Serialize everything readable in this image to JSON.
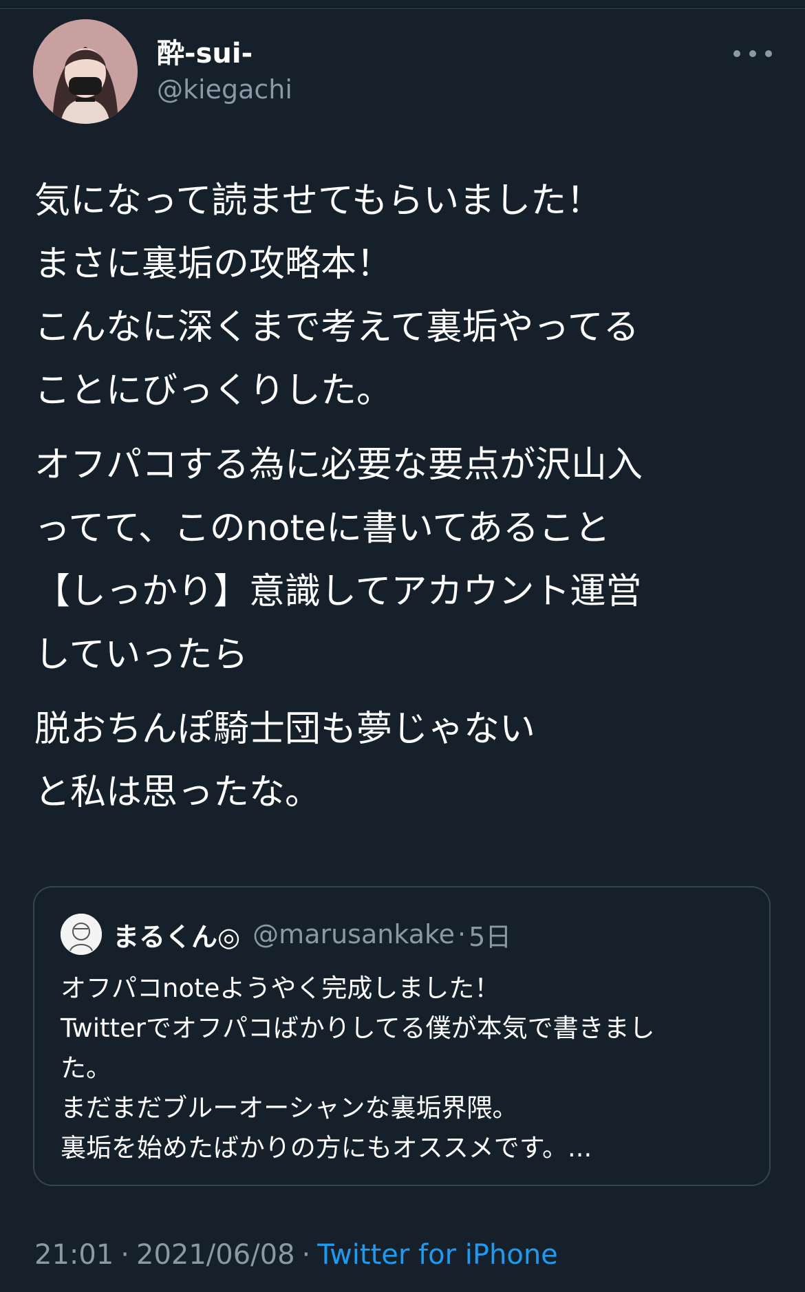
{
  "author": {
    "display_name": "酔-sui-",
    "handle": "@kiegachi"
  },
  "tweet": {
    "paragraphs": [
      [
        "気になって読ませてもらいました！",
        "まさに裏垢の攻略本！",
        "こんなに深くまで考えて裏垢やってる",
        "ことにびっくりした。"
      ],
      [
        "オフパコする為に必要な要点が沢山入",
        "ってて、このnoteに書いてあること",
        "【しっかり】意識してアカウント運営",
        "していったら"
      ],
      [
        "脱おちんぽ騎士団も夢じゃない",
        "と私は思ったな。"
      ]
    ]
  },
  "quote": {
    "display_name": "まるくん◎",
    "handle": "@marusankake",
    "separator": "·",
    "time": "5日",
    "lines": [
      "オフパコnoteようやく完成しました！",
      "Twitterでオフパコばかりしてる僕が本気で書きまし",
      "た。",
      "まだまだブルーオーシャンな裏垢界隈。",
      "裏垢を始めたばかりの方にもオススメです。..."
    ]
  },
  "meta": {
    "time": "21:01",
    "separator": "·",
    "date": "2021/06/08",
    "source": "Twitter for iPhone"
  },
  "colors": {
    "background": "#15202b",
    "text": "#ffffff",
    "secondary": "#8b98a5",
    "accent": "#1d9bf0",
    "border": "#38444d"
  },
  "icons": {
    "more": "more-horizontal-icon"
  }
}
